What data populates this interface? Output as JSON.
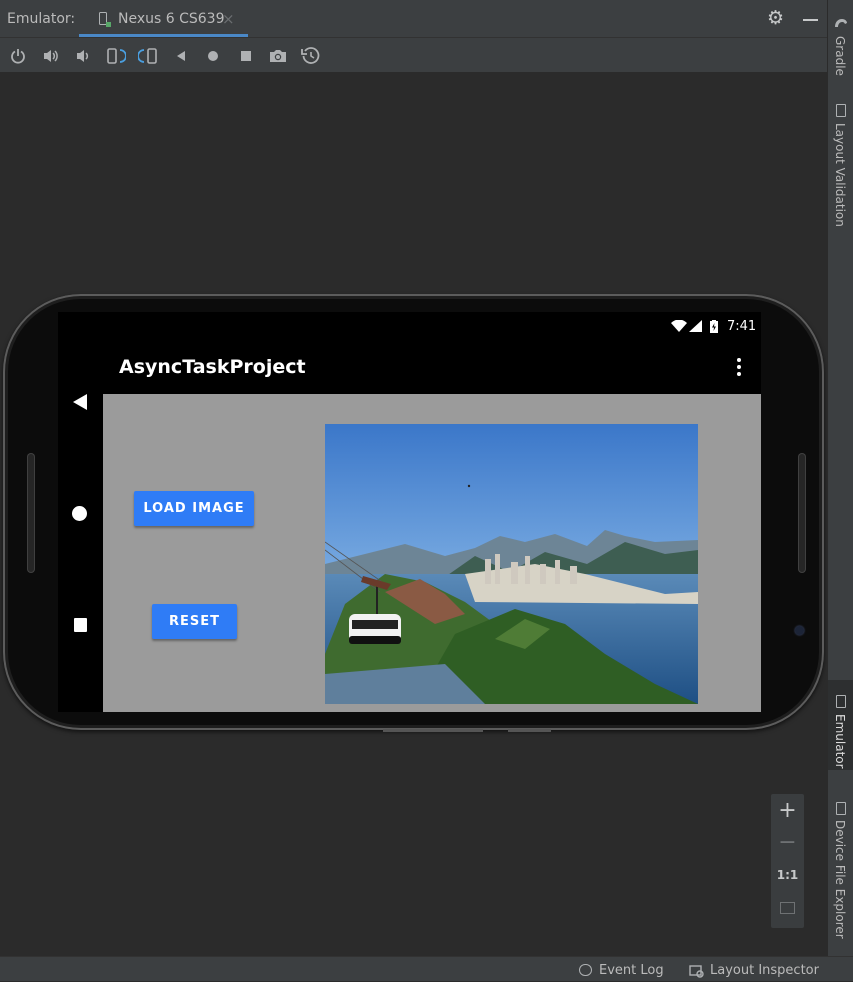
{
  "window": {
    "panel_label": "Emulator:",
    "active_tab": "Nexus 6 CS639",
    "tab_close": "×"
  },
  "toolbar": {
    "buttons": [
      "power",
      "volume-up",
      "volume-down",
      "rotate-left",
      "rotate-right",
      "back",
      "home",
      "overview",
      "screenshot",
      "snapshot"
    ]
  },
  "right_panel": {
    "gradle": "Gradle",
    "layout_validation": "Layout Validation",
    "emulator": "Emulator",
    "device_file_explorer": "Device File Explorer"
  },
  "zoom": {
    "zoom_in": "+",
    "zoom_out": "−",
    "actual_size": "1:1"
  },
  "statusbar": {
    "event_log": "Event Log",
    "layout_inspector": "Layout Inspector"
  },
  "device": {
    "clock": "7:41",
    "app_title": "AsyncTaskProject",
    "load_button": "LOAD IMAGE",
    "reset_button": "RESET"
  },
  "colors": {
    "accent_button": "#2f7cf6",
    "content_bg": "#9b9b9b",
    "ide_bg": "#2b2b2b",
    "tab_underline": "#4a88c7"
  }
}
